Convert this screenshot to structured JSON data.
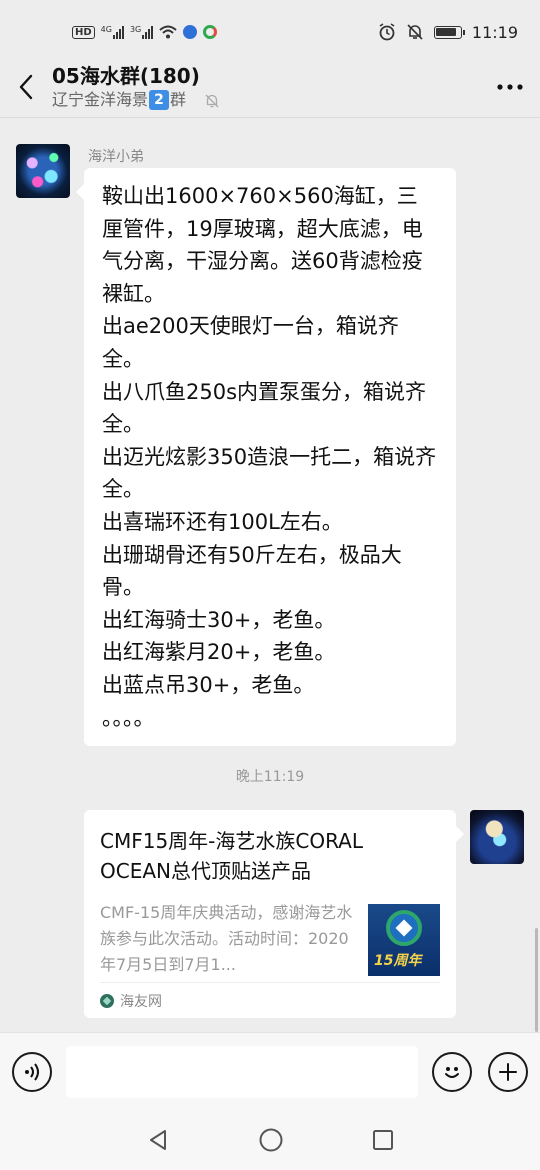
{
  "status_bar": {
    "network_chip": "HD",
    "net_4g": "4G",
    "net_3g": "3G",
    "time": "11:19"
  },
  "header": {
    "title": "05海水群(180)",
    "subtitle_prefix": "辽宁金洋海景",
    "subtitle_badge": "2",
    "subtitle_suffix": "群"
  },
  "messages": [
    {
      "sender": "海洋小弟",
      "text": "鞍山出1600×760×560海缸，三厘管件，19厚玻璃，超大底滤，电气分离，干湿分离。送60背滤检疫裸缸。\n出ae200天使眼灯一台，箱说齐全。\n出八爪鱼250s内置泵蛋分，箱说齐全。\n出迈光炫影350造浪一托二，箱说齐全。\n出喜瑞环还有100L左右。\n出珊瑚骨还有50斤左右，极品大骨。\n出红海骑士30+，老鱼。\n出红海紫月20+，老鱼。\n出蓝点吊30+，老鱼。\n。。。。"
    }
  ],
  "time_divider": "晚上11:19",
  "link_card": {
    "title": "CMF15周年-海艺水族CORAL OCEAN总代顶贴送产品",
    "description": "CMF-15周年庆典活动，感谢海艺水族参与此次活动。活动时间：2020年7月5日到7月1...",
    "thumb_text": "15周年",
    "source": "海友网"
  }
}
